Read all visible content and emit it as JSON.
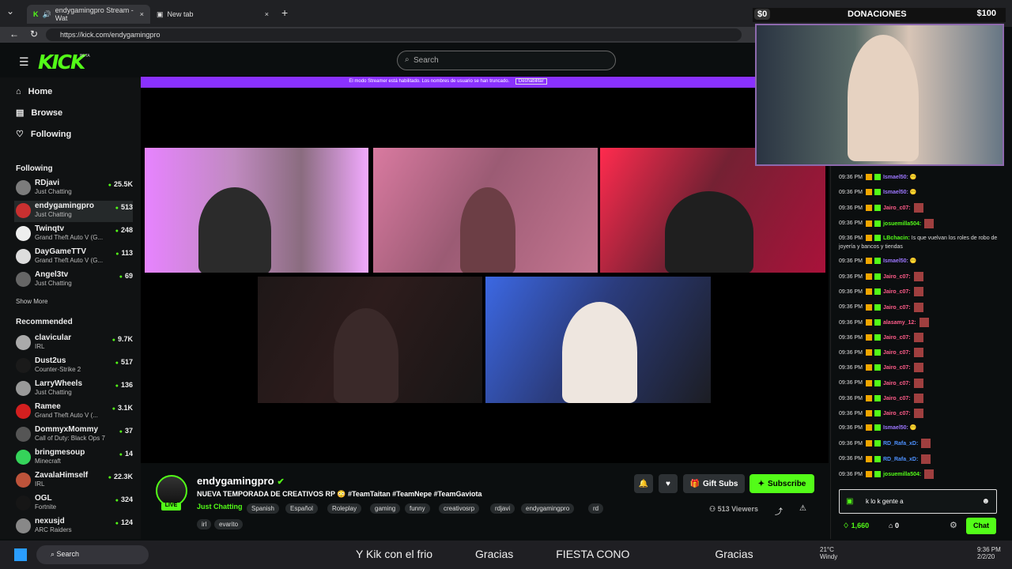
{
  "browser": {
    "tabs": [
      {
        "label": "endygamingpro Stream - Wat"
      },
      {
        "label": "New tab"
      }
    ],
    "url": "https://kick.com/endygamingpro"
  },
  "header": {
    "logo": "KICK",
    "beta": "BETA",
    "search_placeholder": "Search",
    "banner": "El modo Streamer está habilitado. Los nombres de usuario se han truncado.",
    "banner_action": "Deshabilitar"
  },
  "sidebar": {
    "main": [
      {
        "label": "Home"
      },
      {
        "label": "Browse"
      },
      {
        "label": "Following"
      }
    ],
    "following_title": "Following",
    "following": [
      {
        "name": "RDjavi",
        "category": "Just Chatting",
        "count": "25.5K"
      },
      {
        "name": "endygamingpro",
        "category": "Just Chatting",
        "count": "513"
      },
      {
        "name": "Twinqtv",
        "category": "Grand Theft Auto V (G...",
        "count": "248"
      },
      {
        "name": "DayGameTTV",
        "category": "Grand Theft Auto V (G...",
        "count": "113"
      },
      {
        "name": "Angel3tv",
        "category": "Just Chatting",
        "count": "69"
      }
    ],
    "show_more": "Show More",
    "recommended_title": "Recommended",
    "recommended": [
      {
        "name": "clavicular",
        "category": "IRL",
        "count": "9.7K"
      },
      {
        "name": "Dust2us",
        "category": "Counter-Strike 2",
        "count": "517"
      },
      {
        "name": "LarryWheels",
        "category": "Just Chatting",
        "count": "136"
      },
      {
        "name": "Ramee",
        "category": "Grand Theft Auto V (...",
        "count": "3.1K"
      },
      {
        "name": "DommyxMommy",
        "category": "Call of Duty: Black Ops 7",
        "count": "37"
      },
      {
        "name": "bringmesoup",
        "category": "Minecraft",
        "count": "14"
      },
      {
        "name": "ZavalaHimself",
        "category": "IRL",
        "count": "22.3K"
      },
      {
        "name": "OGL",
        "category": "Fortnite",
        "count": "324"
      },
      {
        "name": "nexusjd",
        "category": "ARC Raiders",
        "count": "124"
      }
    ]
  },
  "donations": {
    "min": "$0",
    "title": "DONACIONES",
    "max": "$100"
  },
  "stream": {
    "channel": "endygamingpro",
    "title": "NUEVA TEMPORADA DE CREATIVOS RP 😳 #TeamTaitan #TeamNepe #TeamGaviota",
    "category": "Just Chatting",
    "tags": [
      "Spanish",
      "Español",
      "Roleplay",
      "gaming",
      "funny",
      "creativosrp",
      "rdjavi",
      "endygamingpro",
      "rd",
      "irl",
      "evarito"
    ],
    "live": "LIVE",
    "viewers": "513 Viewers",
    "gift_subs": "Gift Subs",
    "subscribe": "Subscribe"
  },
  "chat": {
    "messages": [
      {
        "time": "09:36 PM",
        "user": "Ismael50:",
        "text": "😶",
        "color": "purple"
      },
      {
        "time": "09:36 PM",
        "user": "Ismael50:",
        "text": "😶",
        "color": "purple"
      },
      {
        "time": "09:36 PM",
        "user": "Jairo_c07:",
        "text": "",
        "color": "red"
      },
      {
        "time": "09:36 PM",
        "user": "josuemilla504:",
        "text": "",
        "color": "green"
      },
      {
        "time": "09:36 PM",
        "user": "LBchacin:",
        "text": "Is que vuelvan los roles de robo de joyería y bancos y tiendas",
        "color": "green"
      },
      {
        "time": "09:36 PM",
        "user": "Ismael50:",
        "text": "😶",
        "color": "purple"
      },
      {
        "time": "09:36 PM",
        "user": "Jairo_c07:",
        "text": "",
        "color": "red"
      },
      {
        "time": "09:36 PM",
        "user": "Jairo_c07:",
        "text": "",
        "color": "red"
      },
      {
        "time": "09:36 PM",
        "user": "Jairo_c07:",
        "text": "",
        "color": "red"
      },
      {
        "time": "09:36 PM",
        "user": "alasamy_12:",
        "text": "",
        "color": "red"
      },
      {
        "time": "09:36 PM",
        "user": "Jairo_c07:",
        "text": "",
        "color": "red"
      },
      {
        "time": "09:36 PM",
        "user": "Jairo_c07:",
        "text": "",
        "color": "red"
      },
      {
        "time": "09:36 PM",
        "user": "Jairo_c07:",
        "text": "",
        "color": "red"
      },
      {
        "time": "09:36 PM",
        "user": "Jairo_c07:",
        "text": "",
        "color": "red"
      },
      {
        "time": "09:36 PM",
        "user": "Jairo_c07:",
        "text": "",
        "color": "red"
      },
      {
        "time": "09:36 PM",
        "user": "Jairo_c07:",
        "text": "",
        "color": "red"
      },
      {
        "time": "09:36 PM",
        "user": "Ismael50:",
        "text": "😶",
        "color": "purple"
      },
      {
        "time": "09:36 PM",
        "user": "RD_Rafa_xD:",
        "text": "",
        "color": "blue"
      },
      {
        "time": "09:36 PM",
        "user": "RD_Rafa_xD:",
        "text": "",
        "color": "blue"
      },
      {
        "time": "09:36 PM",
        "user": "josuemilla504:",
        "text": "",
        "color": "green"
      }
    ],
    "input_value": "k lo k gente a",
    "points": "1,660",
    "stash": "0",
    "send": "Chat"
  },
  "taskbar": {
    "search": "Search",
    "ticker": [
      "Y Kik con el frio",
      "Gracias",
      "FIESTA CONO",
      "",
      "Gracias"
    ],
    "temperature": "21°C",
    "weather": "Windy",
    "time": "9:36 PM",
    "date": "2/2/20"
  },
  "colors": {
    "accent": "#53fc18",
    "purple": "#8a31ff",
    "red": "#ff5c8a",
    "blue": "#4d91ff"
  }
}
